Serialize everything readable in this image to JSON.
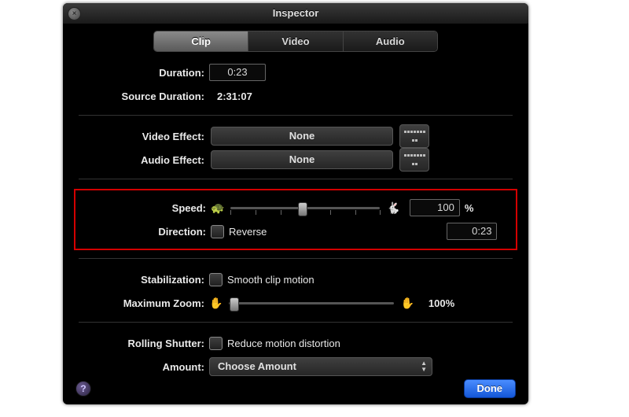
{
  "window": {
    "title": "Inspector",
    "tabs": {
      "clip": "Clip",
      "video": "Video",
      "audio": "Audio"
    }
  },
  "duration": {
    "label": "Duration:",
    "value": "0:23"
  },
  "source_duration": {
    "label": "Source Duration:",
    "value": "2:31:07"
  },
  "video_effect": {
    "label": "Video Effect:",
    "value": "None"
  },
  "audio_effect": {
    "label": "Audio Effect:",
    "value": "None"
  },
  "speed": {
    "label": "Speed:",
    "direction_label": "Direction:",
    "reverse_label": "Reverse",
    "percent": "100",
    "percent_unit": "%",
    "time": "0:23",
    "slider_position_pct": 48
  },
  "stabilization": {
    "label": "Stabilization:",
    "option_label": "Smooth clip motion",
    "max_zoom_label": "Maximum Zoom:",
    "max_zoom_value": "100%"
  },
  "rolling_shutter": {
    "label": "Rolling Shutter:",
    "option_label": "Reduce motion distortion",
    "amount_label": "Amount:",
    "amount_value": "Choose Amount"
  },
  "footer": {
    "help": "?",
    "done": "Done"
  },
  "icons": {
    "close": "×",
    "turtle": "🐢",
    "hare": "🐇",
    "hand": "✋"
  }
}
